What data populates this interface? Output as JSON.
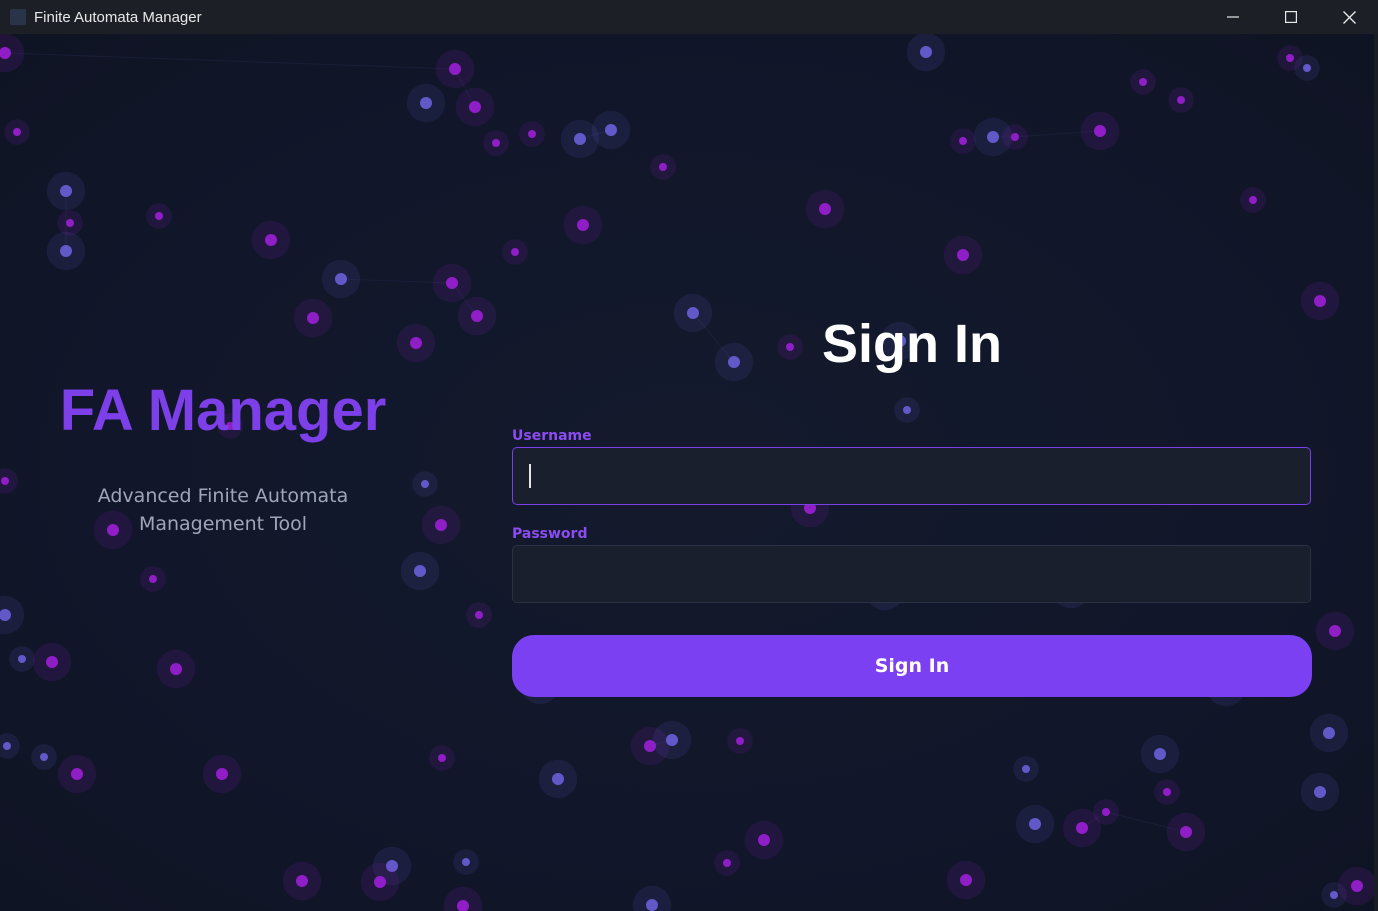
{
  "window": {
    "title": "Finite Automata Manager",
    "controls": [
      "minimize-icon",
      "maximize-icon",
      "close-icon"
    ]
  },
  "brand": {
    "title": "FA Manager",
    "subtitle": "Advanced Finite Automata Management Tool",
    "accent_color": "#7c3fe8"
  },
  "form": {
    "heading": "Sign In",
    "username_label": "Username",
    "username_value": "",
    "password_label": "Password",
    "password_value": "",
    "submit_label": "Sign In",
    "button_color": "#7a40f2"
  },
  "theme": {
    "background": "#121828",
    "particle_purple": "#9b1fd6",
    "particle_blue": "#6a5fd8"
  }
}
